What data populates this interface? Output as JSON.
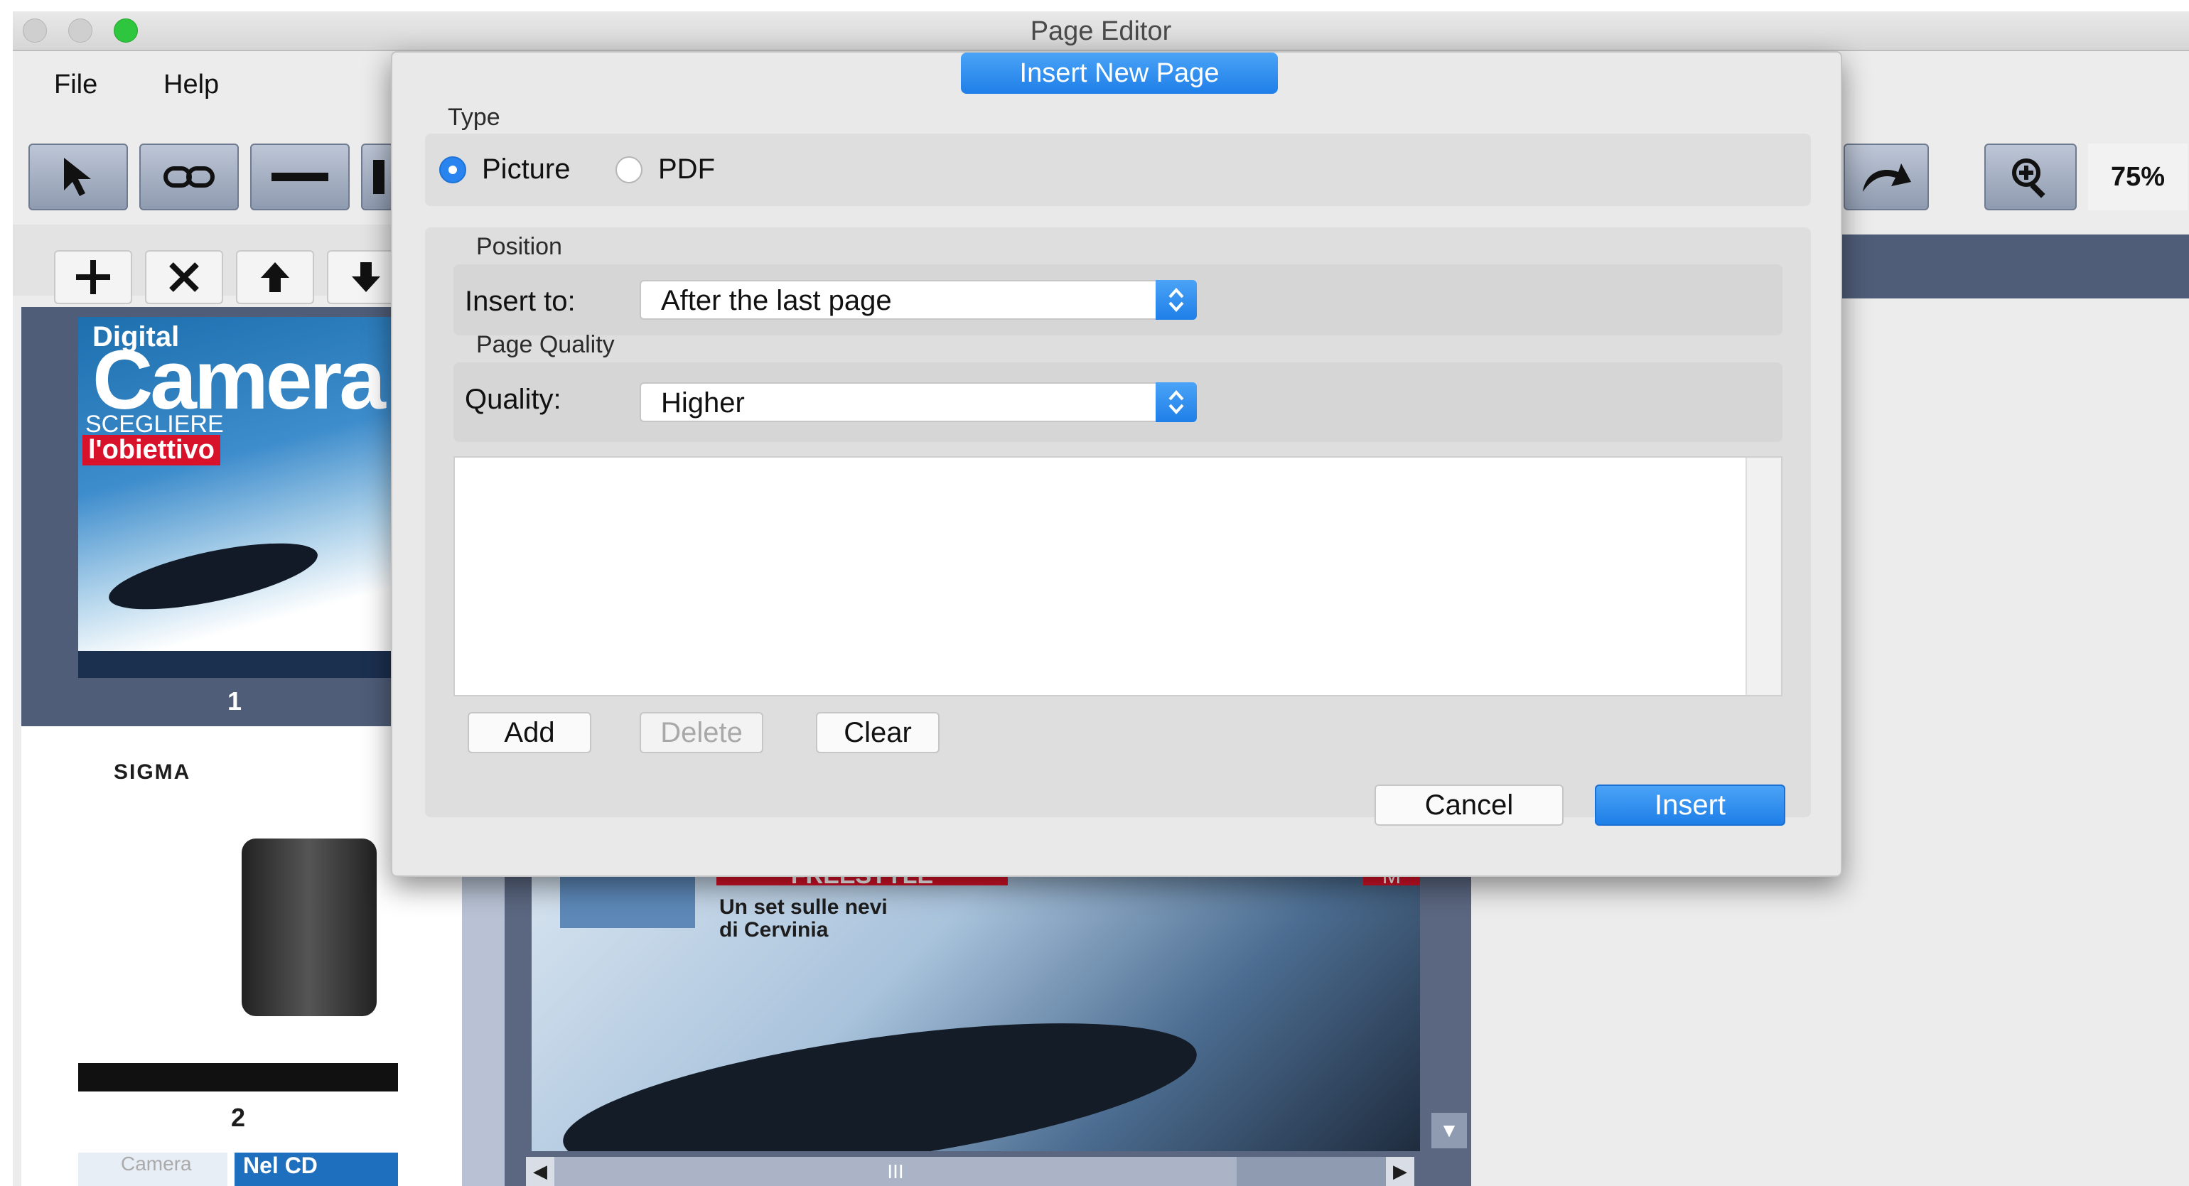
{
  "window": {
    "title": "Page Editor"
  },
  "menu": {
    "items": [
      {
        "label": "File"
      },
      {
        "label": "Help"
      }
    ]
  },
  "toolbar": {
    "zoom_value": "75%",
    "tools": [
      {
        "icon": "cursor-arrow-icon"
      },
      {
        "icon": "link-icon"
      },
      {
        "icon": "line-icon"
      },
      {
        "icon": "rectangle-tool-icon"
      },
      {
        "icon": "redo-arrow-icon"
      },
      {
        "icon": "zoom-in-icon"
      }
    ]
  },
  "page_list": {
    "toolbar": [
      {
        "icon": "plus-icon"
      },
      {
        "icon": "close-x-icon"
      },
      {
        "icon": "arrow-up-icon"
      },
      {
        "icon": "arrow-down-icon"
      }
    ],
    "pages": [
      {
        "number": "1",
        "brand": "Digital",
        "title": "Camera",
        "headline": "SCEGLIERE",
        "banner": "l'obiettivo",
        "selected": true
      },
      {
        "number": "2",
        "brand": "SIGMA",
        "selected": false
      },
      {
        "brand": "Camera",
        "banner": "Nel CD"
      }
    ]
  },
  "document": {
    "headline_banner": "FREESTYLE",
    "headline_line1": "Un set sulle nevi",
    "headline_line2": "di Cervinia",
    "corner_letter": "M",
    "scroll_grip": "III"
  },
  "dialog": {
    "title": "Insert  New Page",
    "type": {
      "label": "Type",
      "options": [
        {
          "label": "Picture",
          "checked": true
        },
        {
          "label": "PDF",
          "checked": false
        }
      ]
    },
    "position": {
      "label": "Position",
      "field_label": "Insert to:",
      "value": "After the last page"
    },
    "quality": {
      "label": "Page Quality",
      "field_label": "Quality:",
      "value": "Higher"
    },
    "list_buttons": {
      "add": "Add",
      "delete": "Delete",
      "clear": "Clear"
    },
    "buttons": {
      "cancel": "Cancel",
      "insert": "Insert"
    }
  },
  "colors": {
    "accent": "#2a84f0",
    "selection_bg": "#4f5d78",
    "close_light": "#c8c8c8",
    "zoom_light": "#2fc63f"
  }
}
